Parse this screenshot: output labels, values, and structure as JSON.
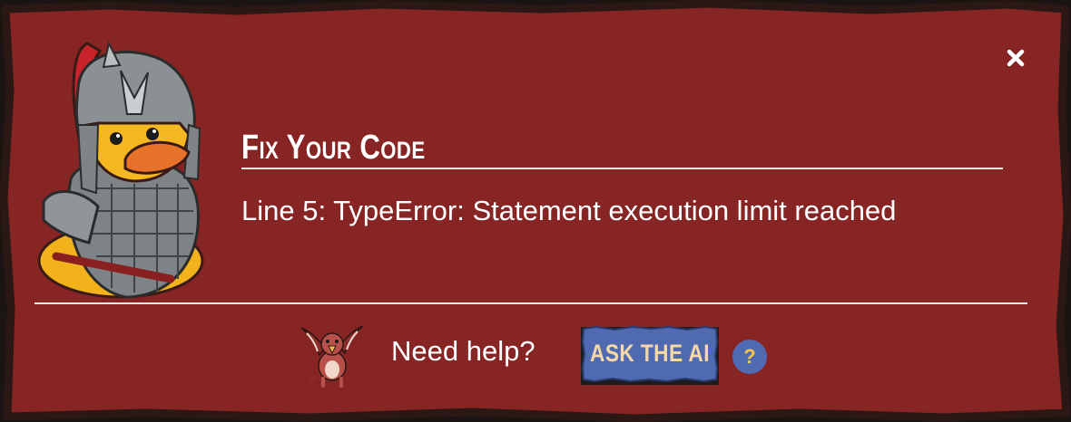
{
  "dialog": {
    "title": "Fix Your Code",
    "message": "Line 5: TypeError: Statement execution limit reached",
    "close_symbol": "×"
  },
  "help": {
    "prompt": "Need help?",
    "ask_button_label": "ASK THE AI",
    "help_icon_glyph": "?"
  },
  "icons": {
    "mascot": "knight-duck-icon",
    "helper": "griffin-icon",
    "close": "close-icon",
    "help": "question-mark-icon"
  },
  "colors": {
    "panel": "#872424",
    "panel_border": "#2b1713",
    "text": "#ffffff",
    "ask_button": "#4f6ab0",
    "ask_text": "#f6d7a8",
    "help_glyph": "#f5c64a"
  }
}
